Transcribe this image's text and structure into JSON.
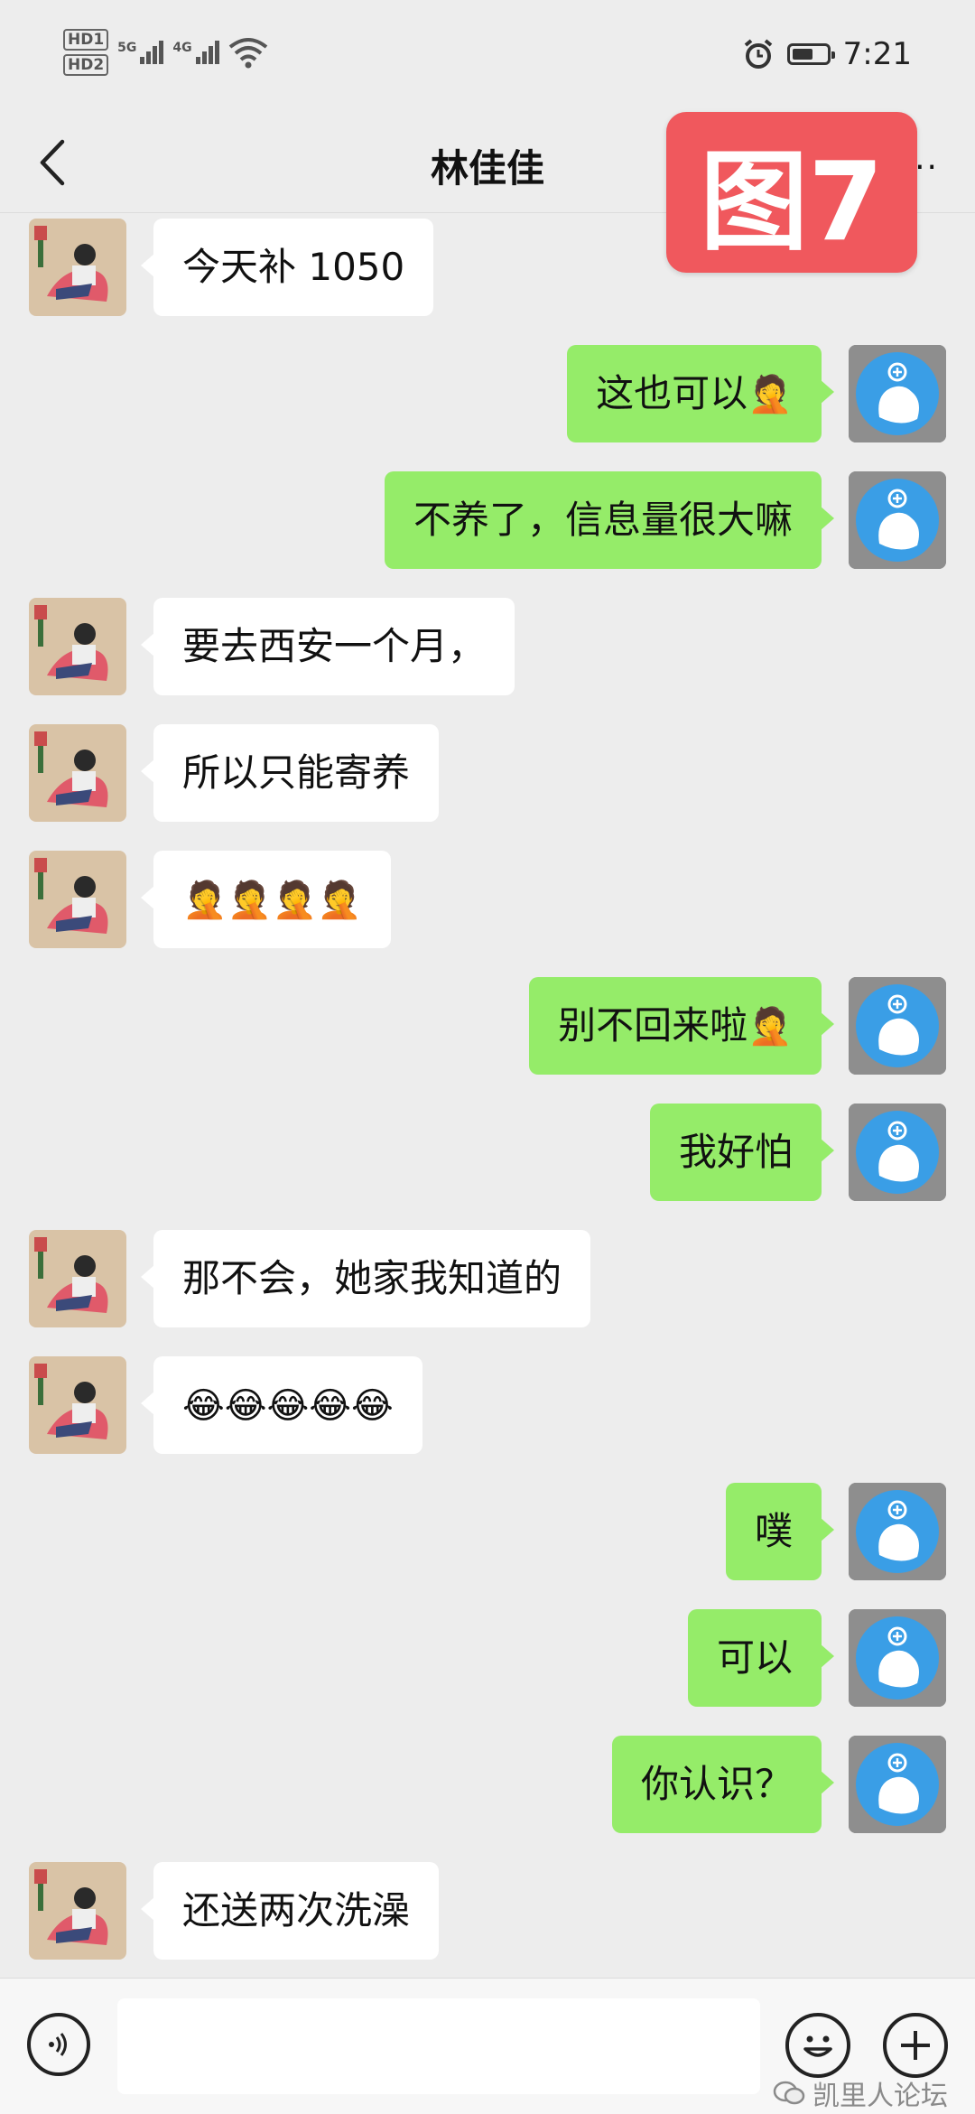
{
  "status_bar": {
    "hd1": "HD1",
    "hd2": "HD2",
    "net1": "5G",
    "net2": "4G",
    "wifi_label": "6",
    "time": "7:21",
    "battery_level": 0.62
  },
  "header": {
    "title": "林佳佳",
    "more": "···",
    "overlay_label": "图7"
  },
  "messages": [
    {
      "side": "left",
      "text": "今天补 1050"
    },
    {
      "side": "right",
      "text": "这也可以",
      "emoji": "🤦"
    },
    {
      "side": "right",
      "text": "不养了，信息量很大嘛"
    },
    {
      "side": "left",
      "text": "要去西安一个月，"
    },
    {
      "side": "left",
      "text": "所以只能寄养"
    },
    {
      "side": "left",
      "text": "",
      "emoji": "🤦🤦🤦🤦"
    },
    {
      "side": "right",
      "text": "别不回来啦",
      "emoji": "🤦"
    },
    {
      "side": "right",
      "text": "我好怕"
    },
    {
      "side": "left",
      "text": "那不会，她家我知道的"
    },
    {
      "side": "left",
      "text": "",
      "emoji": "😂😂😂😂😂"
    },
    {
      "side": "right",
      "text": "噗"
    },
    {
      "side": "right",
      "text": "可以"
    },
    {
      "side": "right",
      "text": "你认识？"
    },
    {
      "side": "left",
      "text": "还送两次洗澡"
    }
  ],
  "input": {
    "value": "",
    "placeholder": ""
  },
  "watermark": {
    "text": "凯里人论坛"
  },
  "colors": {
    "background": "#ededed",
    "bubble_right": "#95ec69",
    "bubble_left": "#ffffff",
    "overlay_badge": "#f0585d"
  }
}
